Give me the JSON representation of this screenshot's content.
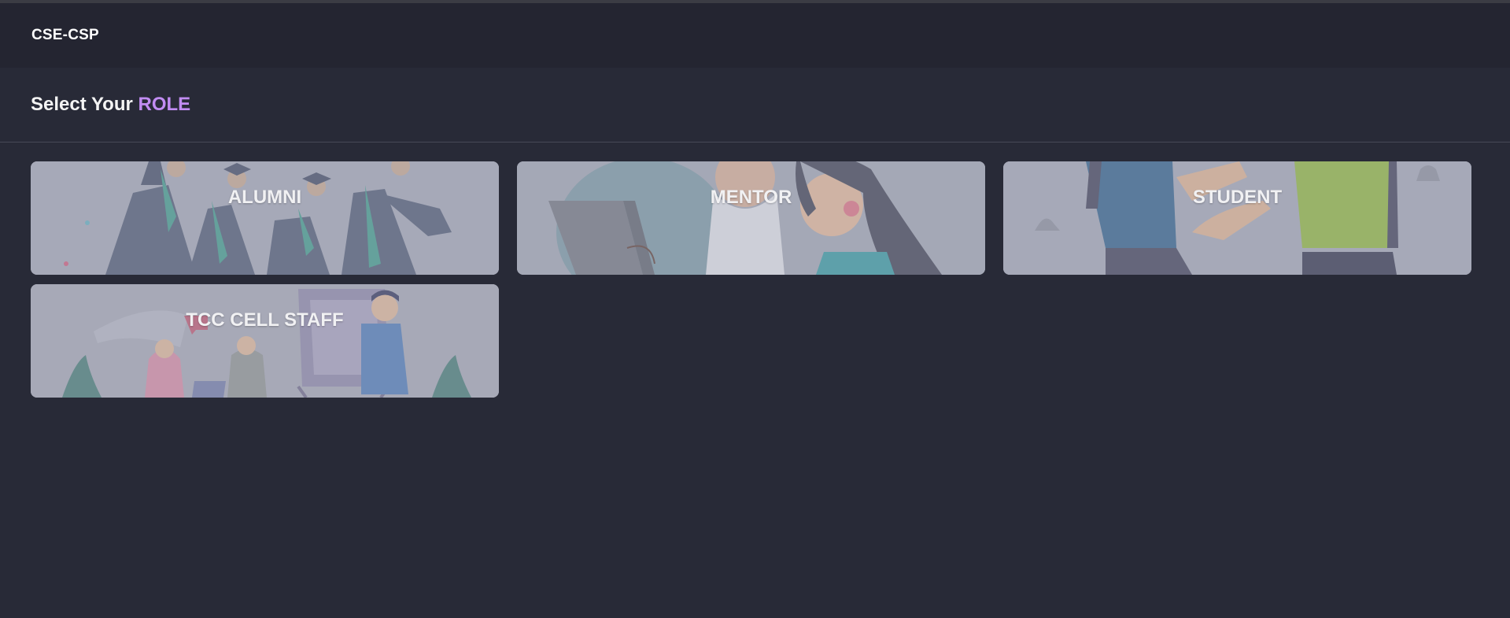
{
  "navbar": {
    "brand": "CSE-CSP"
  },
  "header": {
    "title_prefix": "Select Your",
    "title_accent": "ROLE"
  },
  "roles": [
    {
      "label": "ALUMNI"
    },
    {
      "label": "MENTOR"
    },
    {
      "label": "STUDENT"
    },
    {
      "label": "TCC CELL STAFF"
    }
  ],
  "colors": {
    "background": "#282a37",
    "navbar": "#242531",
    "accent": "#c18cf2"
  }
}
